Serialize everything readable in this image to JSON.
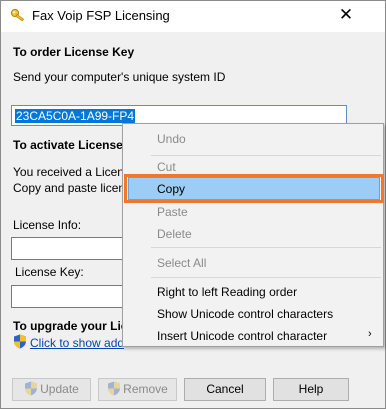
{
  "window": {
    "title": "Fax Voip FSP Licensing",
    "close_glyph": "✕"
  },
  "order": {
    "heading": "To order License Key",
    "send_text": "Send your computer's unique system ID",
    "system_id": "23CA5C0A-1A99-FP4"
  },
  "activate": {
    "heading": "To activate License",
    "received_text": "You received a Licens",
    "copy_text": "Copy and paste licen",
    "license_info_label": "License Info:",
    "license_info_value": "",
    "license_key_label": "License Key:",
    "license_key_value": ""
  },
  "upgrade": {
    "heading": "To upgrade your Lic",
    "link_text": "Click to show add"
  },
  "buttons": {
    "update": "Update",
    "remove": "Remove",
    "cancel": "Cancel",
    "help": "Help"
  },
  "context_menu": {
    "items": [
      {
        "label": "Undo",
        "enabled": false
      },
      {
        "label": "Cut",
        "enabled": false
      },
      {
        "label": "Copy",
        "enabled": true,
        "highlighted": true
      },
      {
        "label": "Paste",
        "enabled": false
      },
      {
        "label": "Delete",
        "enabled": false
      },
      {
        "label": "Select All",
        "enabled": false
      },
      {
        "label": "Right to left Reading order",
        "enabled": true
      },
      {
        "label": "Show Unicode control characters",
        "enabled": true
      },
      {
        "label": "Insert Unicode control character",
        "enabled": true,
        "submenu": true
      }
    ],
    "submenu_glyph": "›"
  },
  "icons": {
    "title": "key-icon",
    "link": "shield-icon",
    "update": "shield-icon",
    "remove": "shield-icon"
  },
  "colors": {
    "selection": "#0078d7",
    "menu_highlight": "#9ccdf6",
    "annotation_frame": "#f0782a",
    "link": "#0645ad"
  }
}
